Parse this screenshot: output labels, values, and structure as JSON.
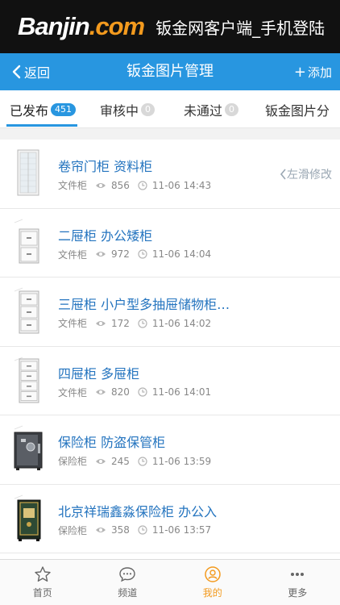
{
  "banner": {
    "logo_main": "Banjin",
    "logo_accent": ".com",
    "slogan": "钣金网客户端_手机登陆"
  },
  "navbar": {
    "back_label": "返回",
    "title": "钣金图片管理",
    "add_label": "添加"
  },
  "tabs": [
    {
      "label": "已发布",
      "count": "451",
      "active": true
    },
    {
      "label": "审核中",
      "count": "0",
      "active": false
    },
    {
      "label": "未通过",
      "count": "0",
      "active": false
    },
    {
      "label": "钣金图片分",
      "count": "",
      "active": false
    }
  ],
  "swipe_hint": "左滑修改",
  "items": [
    {
      "title": "卷帘门柜 资料柜",
      "category": "文件柜",
      "views": "856",
      "time": "11-06 14:43",
      "icon": "roller-door-cabinet"
    },
    {
      "title": "二屉柜 办公矮柜",
      "category": "文件柜",
      "views": "972",
      "time": "11-06 14:04",
      "icon": "two-drawer-cabinet"
    },
    {
      "title": "三屉柜 小户型多抽屉储物柜…",
      "category": "文件柜",
      "views": "172",
      "time": "11-06 14:02",
      "icon": "three-drawer-cabinet"
    },
    {
      "title": "四屉柜 多屉柜",
      "category": "文件柜",
      "views": "820",
      "time": "11-06 14:01",
      "icon": "four-drawer-cabinet"
    },
    {
      "title": "保险柜 防盗保管柜",
      "category": "保险柜",
      "views": "245",
      "time": "11-06 13:59",
      "icon": "safe-dark"
    },
    {
      "title": "北京祥瑞鑫淼保险柜 办公入",
      "category": "保险柜",
      "views": "358",
      "time": "11-06 13:57",
      "icon": "safe-gold"
    }
  ],
  "bottom_nav": [
    {
      "label": "首页",
      "icon": "star-icon",
      "active": false
    },
    {
      "label": "频道",
      "icon": "chat-icon",
      "active": false
    },
    {
      "label": "我的",
      "icon": "user-icon",
      "active": true
    },
    {
      "label": "更多",
      "icon": "more-icon",
      "active": false
    }
  ],
  "colors": {
    "brand_blue": "#2896e0",
    "accent_orange": "#f39a1e",
    "link_blue": "#2474bf"
  }
}
